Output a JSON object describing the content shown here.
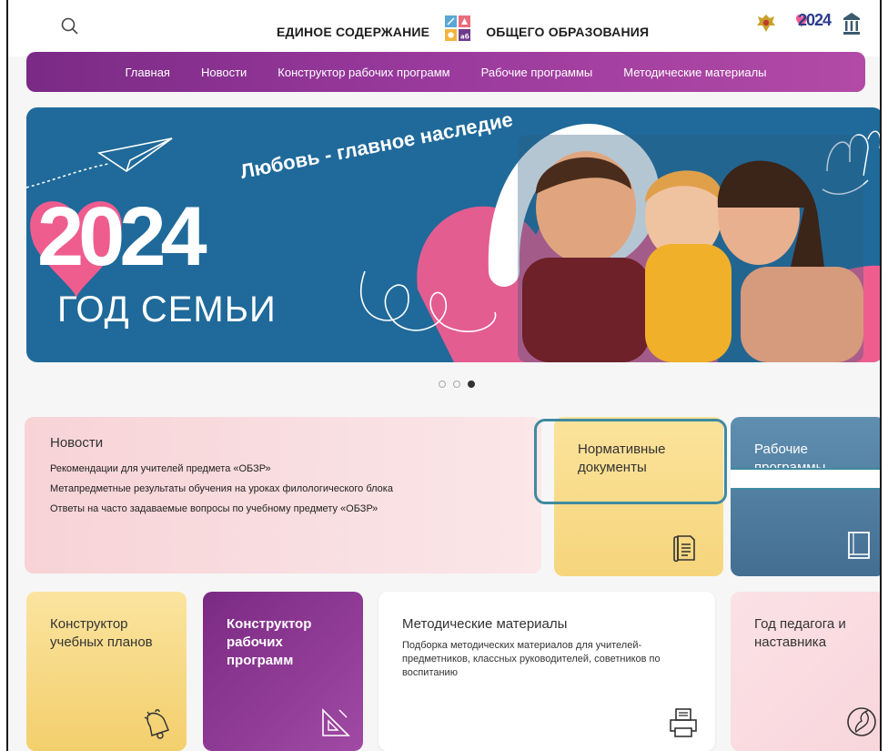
{
  "header": {
    "title_left": "ЕДИНОЕ СОДЕРЖАНИЕ",
    "title_right": "ОБЩЕГО ОБРАЗОВАНИЯ",
    "search_icon": "search-icon",
    "logo_icon": "edsoo-logo",
    "right_logos": [
      "ministry-emblem-icon",
      "year-of-family-logo",
      "academy-logo"
    ],
    "family_year_label": "2024"
  },
  "nav": {
    "items": [
      {
        "label": "Главная"
      },
      {
        "label": "Новости"
      },
      {
        "label": "Конструктор рабочих программ"
      },
      {
        "label": "Рабочие программы"
      },
      {
        "label": "Методические материалы"
      }
    ]
  },
  "banner": {
    "tagline": "Любовь - главное наследие",
    "year": "2024",
    "subtitle": "ГОД СЕМЬИ",
    "slides_total": 3,
    "active_slide": 3
  },
  "news": {
    "heading": "Новости",
    "items": [
      "Рекомендации для учителей предмета «ОБЗР»",
      "Метапредметные результаты обучения на уроках филологического блока",
      "Ответы на часто задаваемые вопросы по учебному предмету «ОБЗР»"
    ]
  },
  "cards": {
    "normdoc": {
      "title": "Нормативные документы",
      "icon": "document-icon"
    },
    "programs": {
      "title": "Рабочие программы",
      "icon": "book-icon"
    },
    "plans": {
      "title": "Конструктор учебных планов",
      "icon": "bell-icon"
    },
    "constructor": {
      "title": "Конструктор рабочих программ",
      "icon": "ruler-triangle-icon"
    },
    "methods": {
      "title": "Методические материалы",
      "description": "Подборка методических материалов для учителей-предметников, классных руководителей, советников по воспитанию",
      "icon": "printer-icon"
    },
    "teacher": {
      "title": "Год педагога и наставника",
      "icon": "crane-icon"
    }
  },
  "colors": {
    "nav_gradient_start": "#7b2a86",
    "nav_gradient_end": "#b24aa6",
    "banner_bg": "#1f6a9a",
    "banner_heart": "#ef5d8f",
    "highlight_border": "#3f8aa0"
  }
}
